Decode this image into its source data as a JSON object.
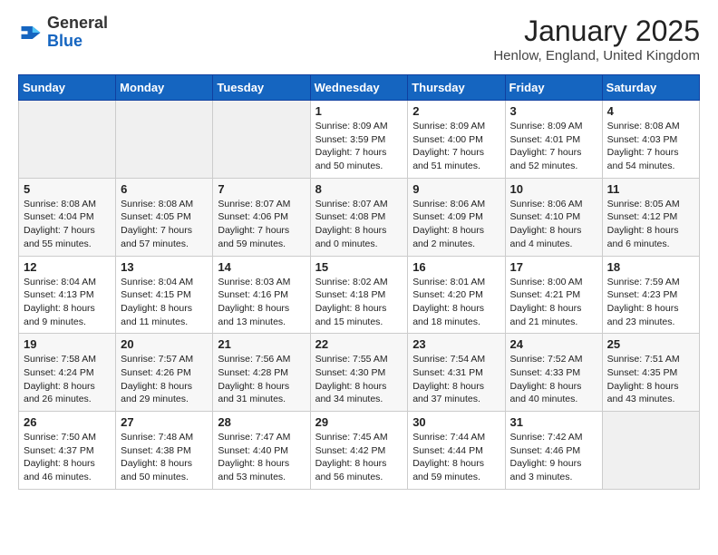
{
  "header": {
    "logo_general": "General",
    "logo_blue": "Blue",
    "month_title": "January 2025",
    "location": "Henlow, England, United Kingdom"
  },
  "weekdays": [
    "Sunday",
    "Monday",
    "Tuesday",
    "Wednesday",
    "Thursday",
    "Friday",
    "Saturday"
  ],
  "weeks": [
    [
      {
        "day": "",
        "info": ""
      },
      {
        "day": "",
        "info": ""
      },
      {
        "day": "",
        "info": ""
      },
      {
        "day": "1",
        "info": "Sunrise: 8:09 AM\nSunset: 3:59 PM\nDaylight: 7 hours\nand 50 minutes."
      },
      {
        "day": "2",
        "info": "Sunrise: 8:09 AM\nSunset: 4:00 PM\nDaylight: 7 hours\nand 51 minutes."
      },
      {
        "day": "3",
        "info": "Sunrise: 8:09 AM\nSunset: 4:01 PM\nDaylight: 7 hours\nand 52 minutes."
      },
      {
        "day": "4",
        "info": "Sunrise: 8:08 AM\nSunset: 4:03 PM\nDaylight: 7 hours\nand 54 minutes."
      }
    ],
    [
      {
        "day": "5",
        "info": "Sunrise: 8:08 AM\nSunset: 4:04 PM\nDaylight: 7 hours\nand 55 minutes."
      },
      {
        "day": "6",
        "info": "Sunrise: 8:08 AM\nSunset: 4:05 PM\nDaylight: 7 hours\nand 57 minutes."
      },
      {
        "day": "7",
        "info": "Sunrise: 8:07 AM\nSunset: 4:06 PM\nDaylight: 7 hours\nand 59 minutes."
      },
      {
        "day": "8",
        "info": "Sunrise: 8:07 AM\nSunset: 4:08 PM\nDaylight: 8 hours\nand 0 minutes."
      },
      {
        "day": "9",
        "info": "Sunrise: 8:06 AM\nSunset: 4:09 PM\nDaylight: 8 hours\nand 2 minutes."
      },
      {
        "day": "10",
        "info": "Sunrise: 8:06 AM\nSunset: 4:10 PM\nDaylight: 8 hours\nand 4 minutes."
      },
      {
        "day": "11",
        "info": "Sunrise: 8:05 AM\nSunset: 4:12 PM\nDaylight: 8 hours\nand 6 minutes."
      }
    ],
    [
      {
        "day": "12",
        "info": "Sunrise: 8:04 AM\nSunset: 4:13 PM\nDaylight: 8 hours\nand 9 minutes."
      },
      {
        "day": "13",
        "info": "Sunrise: 8:04 AM\nSunset: 4:15 PM\nDaylight: 8 hours\nand 11 minutes."
      },
      {
        "day": "14",
        "info": "Sunrise: 8:03 AM\nSunset: 4:16 PM\nDaylight: 8 hours\nand 13 minutes."
      },
      {
        "day": "15",
        "info": "Sunrise: 8:02 AM\nSunset: 4:18 PM\nDaylight: 8 hours\nand 15 minutes."
      },
      {
        "day": "16",
        "info": "Sunrise: 8:01 AM\nSunset: 4:20 PM\nDaylight: 8 hours\nand 18 minutes."
      },
      {
        "day": "17",
        "info": "Sunrise: 8:00 AM\nSunset: 4:21 PM\nDaylight: 8 hours\nand 21 minutes."
      },
      {
        "day": "18",
        "info": "Sunrise: 7:59 AM\nSunset: 4:23 PM\nDaylight: 8 hours\nand 23 minutes."
      }
    ],
    [
      {
        "day": "19",
        "info": "Sunrise: 7:58 AM\nSunset: 4:24 PM\nDaylight: 8 hours\nand 26 minutes."
      },
      {
        "day": "20",
        "info": "Sunrise: 7:57 AM\nSunset: 4:26 PM\nDaylight: 8 hours\nand 29 minutes."
      },
      {
        "day": "21",
        "info": "Sunrise: 7:56 AM\nSunset: 4:28 PM\nDaylight: 8 hours\nand 31 minutes."
      },
      {
        "day": "22",
        "info": "Sunrise: 7:55 AM\nSunset: 4:30 PM\nDaylight: 8 hours\nand 34 minutes."
      },
      {
        "day": "23",
        "info": "Sunrise: 7:54 AM\nSunset: 4:31 PM\nDaylight: 8 hours\nand 37 minutes."
      },
      {
        "day": "24",
        "info": "Sunrise: 7:52 AM\nSunset: 4:33 PM\nDaylight: 8 hours\nand 40 minutes."
      },
      {
        "day": "25",
        "info": "Sunrise: 7:51 AM\nSunset: 4:35 PM\nDaylight: 8 hours\nand 43 minutes."
      }
    ],
    [
      {
        "day": "26",
        "info": "Sunrise: 7:50 AM\nSunset: 4:37 PM\nDaylight: 8 hours\nand 46 minutes."
      },
      {
        "day": "27",
        "info": "Sunrise: 7:48 AM\nSunset: 4:38 PM\nDaylight: 8 hours\nand 50 minutes."
      },
      {
        "day": "28",
        "info": "Sunrise: 7:47 AM\nSunset: 4:40 PM\nDaylight: 8 hours\nand 53 minutes."
      },
      {
        "day": "29",
        "info": "Sunrise: 7:45 AM\nSunset: 4:42 PM\nDaylight: 8 hours\nand 56 minutes."
      },
      {
        "day": "30",
        "info": "Sunrise: 7:44 AM\nSunset: 4:44 PM\nDaylight: 8 hours\nand 59 minutes."
      },
      {
        "day": "31",
        "info": "Sunrise: 7:42 AM\nSunset: 4:46 PM\nDaylight: 9 hours\nand 3 minutes."
      },
      {
        "day": "",
        "info": ""
      }
    ]
  ]
}
